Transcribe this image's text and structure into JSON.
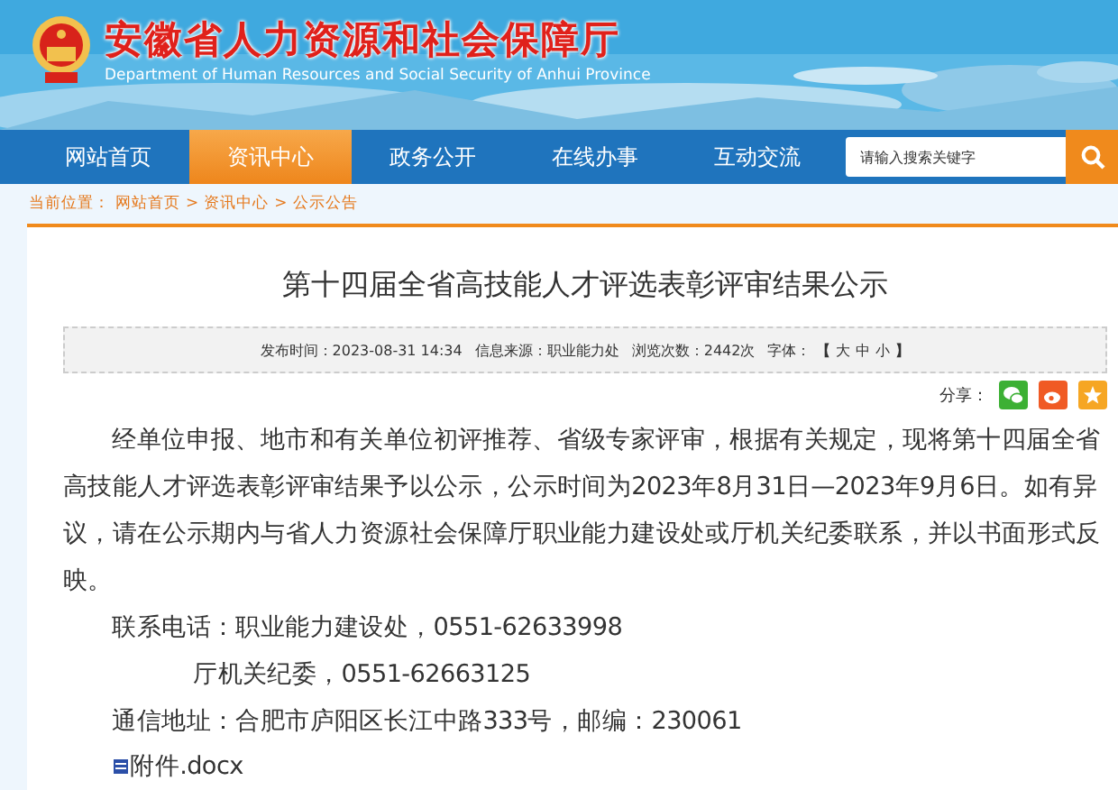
{
  "header": {
    "title": "安徽省人力资源和社会保障厅",
    "subtitle": "Department of Human Resources and Social Security of Anhui Province"
  },
  "nav": [
    {
      "label": "网站首页",
      "selected": false
    },
    {
      "label": "资讯中心",
      "selected": true
    },
    {
      "label": "政务公开",
      "selected": false
    },
    {
      "label": "在线办事",
      "selected": false
    },
    {
      "label": "互动交流",
      "selected": false
    }
  ],
  "search": {
    "placeholder": "请输入搜索关键字"
  },
  "breadcrumb": {
    "label": "当前位置：",
    "items": [
      "网站首页",
      "资讯中心",
      "公示公告"
    ],
    "separator": ">"
  },
  "article": {
    "title": "第十四届全省高技能人才评选表彰评审结果公示",
    "meta": {
      "published": "发布时间：2023-08-31 14:34",
      "source": "信息来源：职业能力处",
      "views": "浏览次数：2442次",
      "font_label": "字体：",
      "font_sizes": [
        "大",
        "中",
        "小"
      ],
      "bracket_open": "【",
      "bracket_close": "】"
    },
    "share_label": "分享：",
    "paragraphs": [
      {
        "kind": "indent",
        "text": "经单位申报、地市和有关单位初评推荐、省级专家评审，根据有关规定，现将第十四届全省高技能人才评选表彰评审结果予以公示，公示时间为2023年8月31日—2023年9月6日。如有异议，请在公示期内与省人力资源社会保障厅职业能力建设处或厅机关纪委联系，并以书面形式反映。"
      },
      {
        "kind": "line",
        "text": "联系电话：职业能力建设处，0551-62633998"
      },
      {
        "kind": "hang",
        "text": "厅机关纪委，0551-62663125"
      },
      {
        "kind": "line",
        "text": "通信地址：合肥市庐阳区长江中路333号，邮编：230061"
      }
    ],
    "attachment": "附件.docx"
  }
}
